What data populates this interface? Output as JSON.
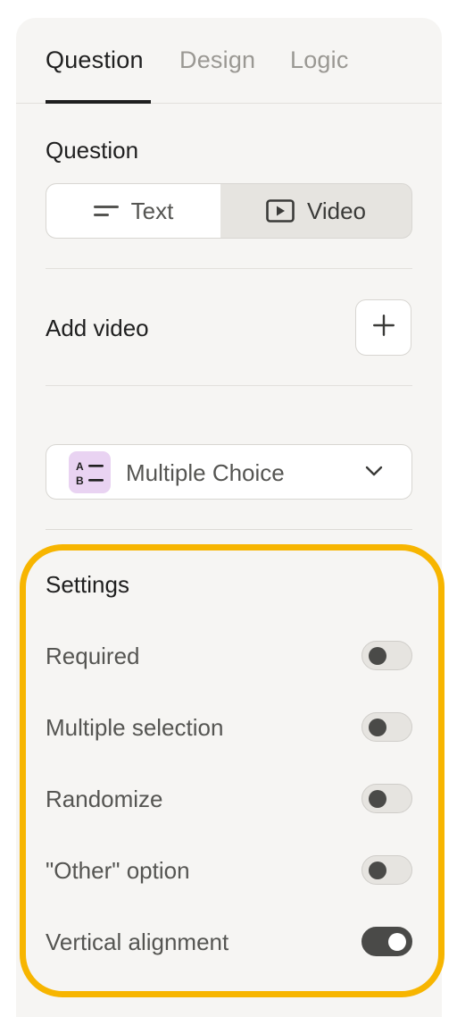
{
  "tabs": [
    {
      "label": "Question",
      "active": true
    },
    {
      "label": "Design",
      "active": false
    },
    {
      "label": "Logic",
      "active": false
    }
  ],
  "question_section": {
    "title": "Question",
    "mode_options": [
      {
        "label": "Text",
        "icon": "text-lines-icon",
        "selected": false
      },
      {
        "label": "Video",
        "icon": "video-play-icon",
        "selected": true
      }
    ]
  },
  "add_video": {
    "label": "Add video",
    "button_icon": "plus-icon"
  },
  "question_type": {
    "label": "Multiple Choice",
    "icon": "multiple-choice-icon",
    "icon_text": [
      "A",
      "B"
    ]
  },
  "settings": {
    "title": "Settings",
    "items": [
      {
        "label": "Required",
        "enabled": false
      },
      {
        "label": "Multiple selection",
        "enabled": false
      },
      {
        "label": "Randomize",
        "enabled": false
      },
      {
        "label": "\"Other\" option",
        "enabled": false
      },
      {
        "label": "Vertical alignment",
        "enabled": true
      }
    ]
  },
  "colors": {
    "panel_bg": "#f6f5f3",
    "highlight": "#f7b500",
    "choice_icon_bg": "#e9d3f2",
    "toggle_on": "#4a4a48"
  }
}
